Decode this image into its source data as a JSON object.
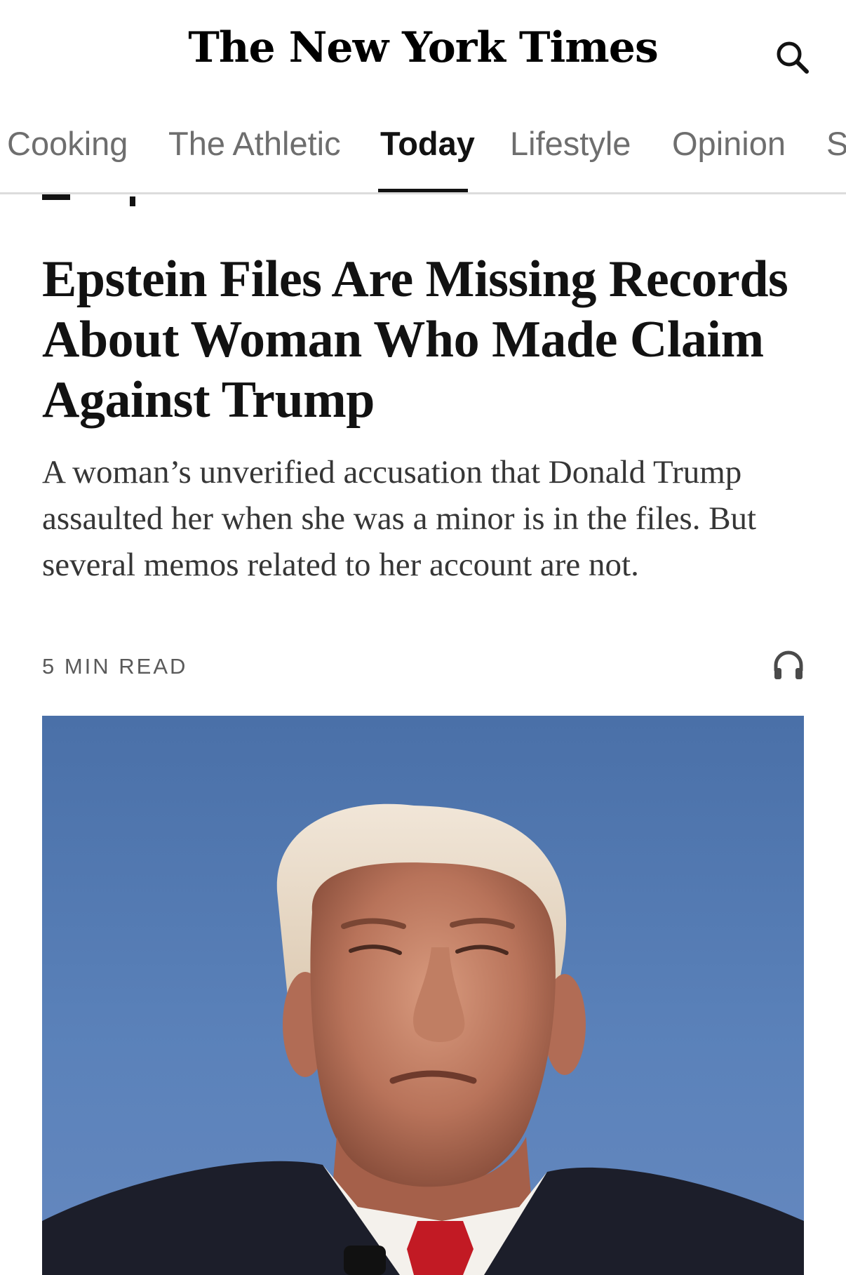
{
  "masthead": {
    "logo_text": "The New York Times",
    "search_icon": "search-icon"
  },
  "nav": {
    "tabs": [
      {
        "label": "Cooking",
        "active": false
      },
      {
        "label": "The Athletic",
        "active": false
      },
      {
        "label": "Today",
        "active": true
      },
      {
        "label": "Lifestyle",
        "active": false
      },
      {
        "label": "Opinion",
        "active": false
      },
      {
        "label": "S",
        "active": false
      }
    ]
  },
  "article": {
    "headline": "Epstein Files Are Missing Records About Woman Who Made Claim Against Trump",
    "summary": "A woman’s unverified accusation that Donald Trump assaulted her when she was a minor is in the files. But several memos related to her account are not.",
    "read_time": "5 MIN READ",
    "listen_icon": "headphones-icon"
  },
  "colors": {
    "text_primary": "#121212",
    "text_muted": "#6e6e6e",
    "divider": "#dcdcdc",
    "sky": "#5b82ba"
  }
}
